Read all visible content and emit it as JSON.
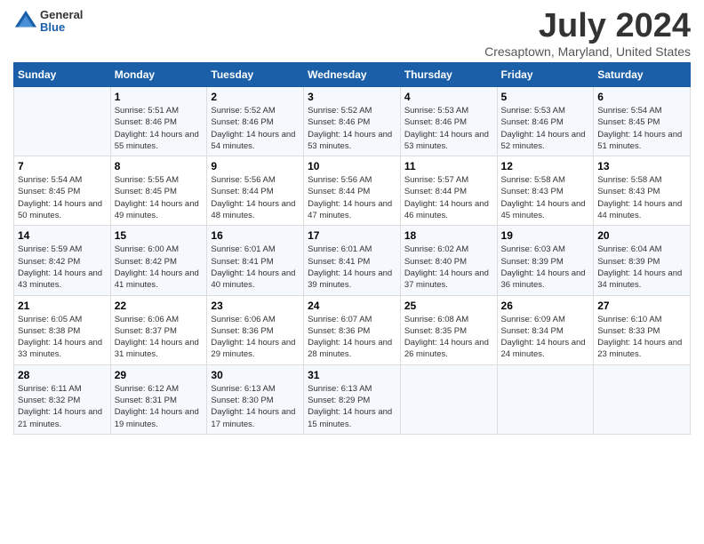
{
  "header": {
    "logo_general": "General",
    "logo_blue": "Blue",
    "month_title": "July 2024",
    "location": "Cresaptown, Maryland, United States"
  },
  "weekdays": [
    "Sunday",
    "Monday",
    "Tuesday",
    "Wednesday",
    "Thursday",
    "Friday",
    "Saturday"
  ],
  "weeks": [
    [
      {
        "day": "",
        "sunrise": "",
        "sunset": "",
        "daylight": ""
      },
      {
        "day": "1",
        "sunrise": "Sunrise: 5:51 AM",
        "sunset": "Sunset: 8:46 PM",
        "daylight": "Daylight: 14 hours and 55 minutes."
      },
      {
        "day": "2",
        "sunrise": "Sunrise: 5:52 AM",
        "sunset": "Sunset: 8:46 PM",
        "daylight": "Daylight: 14 hours and 54 minutes."
      },
      {
        "day": "3",
        "sunrise": "Sunrise: 5:52 AM",
        "sunset": "Sunset: 8:46 PM",
        "daylight": "Daylight: 14 hours and 53 minutes."
      },
      {
        "day": "4",
        "sunrise": "Sunrise: 5:53 AM",
        "sunset": "Sunset: 8:46 PM",
        "daylight": "Daylight: 14 hours and 53 minutes."
      },
      {
        "day": "5",
        "sunrise": "Sunrise: 5:53 AM",
        "sunset": "Sunset: 8:46 PM",
        "daylight": "Daylight: 14 hours and 52 minutes."
      },
      {
        "day": "6",
        "sunrise": "Sunrise: 5:54 AM",
        "sunset": "Sunset: 8:45 PM",
        "daylight": "Daylight: 14 hours and 51 minutes."
      }
    ],
    [
      {
        "day": "7",
        "sunrise": "Sunrise: 5:54 AM",
        "sunset": "Sunset: 8:45 PM",
        "daylight": "Daylight: 14 hours and 50 minutes."
      },
      {
        "day": "8",
        "sunrise": "Sunrise: 5:55 AM",
        "sunset": "Sunset: 8:45 PM",
        "daylight": "Daylight: 14 hours and 49 minutes."
      },
      {
        "day": "9",
        "sunrise": "Sunrise: 5:56 AM",
        "sunset": "Sunset: 8:44 PM",
        "daylight": "Daylight: 14 hours and 48 minutes."
      },
      {
        "day": "10",
        "sunrise": "Sunrise: 5:56 AM",
        "sunset": "Sunset: 8:44 PM",
        "daylight": "Daylight: 14 hours and 47 minutes."
      },
      {
        "day": "11",
        "sunrise": "Sunrise: 5:57 AM",
        "sunset": "Sunset: 8:44 PM",
        "daylight": "Daylight: 14 hours and 46 minutes."
      },
      {
        "day": "12",
        "sunrise": "Sunrise: 5:58 AM",
        "sunset": "Sunset: 8:43 PM",
        "daylight": "Daylight: 14 hours and 45 minutes."
      },
      {
        "day": "13",
        "sunrise": "Sunrise: 5:58 AM",
        "sunset": "Sunset: 8:43 PM",
        "daylight": "Daylight: 14 hours and 44 minutes."
      }
    ],
    [
      {
        "day": "14",
        "sunrise": "Sunrise: 5:59 AM",
        "sunset": "Sunset: 8:42 PM",
        "daylight": "Daylight: 14 hours and 43 minutes."
      },
      {
        "day": "15",
        "sunrise": "Sunrise: 6:00 AM",
        "sunset": "Sunset: 8:42 PM",
        "daylight": "Daylight: 14 hours and 41 minutes."
      },
      {
        "day": "16",
        "sunrise": "Sunrise: 6:01 AM",
        "sunset": "Sunset: 8:41 PM",
        "daylight": "Daylight: 14 hours and 40 minutes."
      },
      {
        "day": "17",
        "sunrise": "Sunrise: 6:01 AM",
        "sunset": "Sunset: 8:41 PM",
        "daylight": "Daylight: 14 hours and 39 minutes."
      },
      {
        "day": "18",
        "sunrise": "Sunrise: 6:02 AM",
        "sunset": "Sunset: 8:40 PM",
        "daylight": "Daylight: 14 hours and 37 minutes."
      },
      {
        "day": "19",
        "sunrise": "Sunrise: 6:03 AM",
        "sunset": "Sunset: 8:39 PM",
        "daylight": "Daylight: 14 hours and 36 minutes."
      },
      {
        "day": "20",
        "sunrise": "Sunrise: 6:04 AM",
        "sunset": "Sunset: 8:39 PM",
        "daylight": "Daylight: 14 hours and 34 minutes."
      }
    ],
    [
      {
        "day": "21",
        "sunrise": "Sunrise: 6:05 AM",
        "sunset": "Sunset: 8:38 PM",
        "daylight": "Daylight: 14 hours and 33 minutes."
      },
      {
        "day": "22",
        "sunrise": "Sunrise: 6:06 AM",
        "sunset": "Sunset: 8:37 PM",
        "daylight": "Daylight: 14 hours and 31 minutes."
      },
      {
        "day": "23",
        "sunrise": "Sunrise: 6:06 AM",
        "sunset": "Sunset: 8:36 PM",
        "daylight": "Daylight: 14 hours and 29 minutes."
      },
      {
        "day": "24",
        "sunrise": "Sunrise: 6:07 AM",
        "sunset": "Sunset: 8:36 PM",
        "daylight": "Daylight: 14 hours and 28 minutes."
      },
      {
        "day": "25",
        "sunrise": "Sunrise: 6:08 AM",
        "sunset": "Sunset: 8:35 PM",
        "daylight": "Daylight: 14 hours and 26 minutes."
      },
      {
        "day": "26",
        "sunrise": "Sunrise: 6:09 AM",
        "sunset": "Sunset: 8:34 PM",
        "daylight": "Daylight: 14 hours and 24 minutes."
      },
      {
        "day": "27",
        "sunrise": "Sunrise: 6:10 AM",
        "sunset": "Sunset: 8:33 PM",
        "daylight": "Daylight: 14 hours and 23 minutes."
      }
    ],
    [
      {
        "day": "28",
        "sunrise": "Sunrise: 6:11 AM",
        "sunset": "Sunset: 8:32 PM",
        "daylight": "Daylight: 14 hours and 21 minutes."
      },
      {
        "day": "29",
        "sunrise": "Sunrise: 6:12 AM",
        "sunset": "Sunset: 8:31 PM",
        "daylight": "Daylight: 14 hours and 19 minutes."
      },
      {
        "day": "30",
        "sunrise": "Sunrise: 6:13 AM",
        "sunset": "Sunset: 8:30 PM",
        "daylight": "Daylight: 14 hours and 17 minutes."
      },
      {
        "day": "31",
        "sunrise": "Sunrise: 6:13 AM",
        "sunset": "Sunset: 8:29 PM",
        "daylight": "Daylight: 14 hours and 15 minutes."
      },
      {
        "day": "",
        "sunrise": "",
        "sunset": "",
        "daylight": ""
      },
      {
        "day": "",
        "sunrise": "",
        "sunset": "",
        "daylight": ""
      },
      {
        "day": "",
        "sunrise": "",
        "sunset": "",
        "daylight": ""
      }
    ]
  ]
}
